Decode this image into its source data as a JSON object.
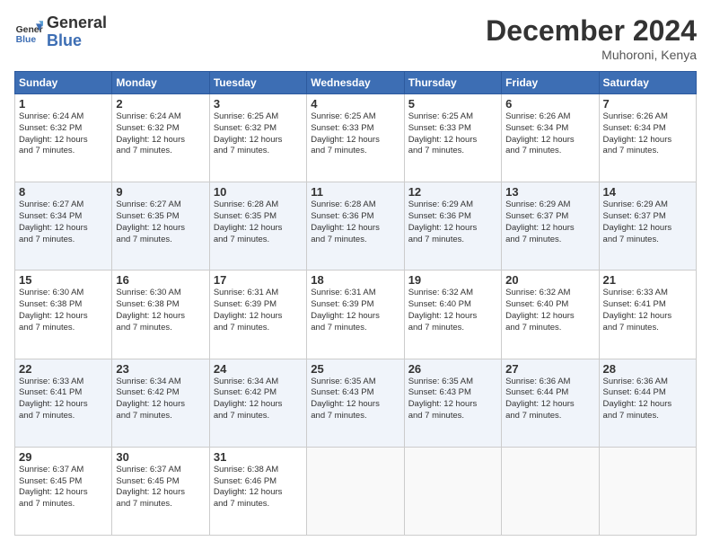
{
  "logo": {
    "line1": "General",
    "line2": "Blue"
  },
  "title": "December 2024",
  "subtitle": "Muhoroni, Kenya",
  "days_header": [
    "Sunday",
    "Monday",
    "Tuesday",
    "Wednesday",
    "Thursday",
    "Friday",
    "Saturday"
  ],
  "weeks": [
    [
      {
        "day": "1",
        "sunrise": "6:24 AM",
        "sunset": "6:32 PM",
        "daylight": "12 hours and 7 minutes."
      },
      {
        "day": "2",
        "sunrise": "6:24 AM",
        "sunset": "6:32 PM",
        "daylight": "12 hours and 7 minutes."
      },
      {
        "day": "3",
        "sunrise": "6:25 AM",
        "sunset": "6:32 PM",
        "daylight": "12 hours and 7 minutes."
      },
      {
        "day": "4",
        "sunrise": "6:25 AM",
        "sunset": "6:33 PM",
        "daylight": "12 hours and 7 minutes."
      },
      {
        "day": "5",
        "sunrise": "6:25 AM",
        "sunset": "6:33 PM",
        "daylight": "12 hours and 7 minutes."
      },
      {
        "day": "6",
        "sunrise": "6:26 AM",
        "sunset": "6:34 PM",
        "daylight": "12 hours and 7 minutes."
      },
      {
        "day": "7",
        "sunrise": "6:26 AM",
        "sunset": "6:34 PM",
        "daylight": "12 hours and 7 minutes."
      }
    ],
    [
      {
        "day": "8",
        "sunrise": "6:27 AM",
        "sunset": "6:34 PM",
        "daylight": "12 hours and 7 minutes."
      },
      {
        "day": "9",
        "sunrise": "6:27 AM",
        "sunset": "6:35 PM",
        "daylight": "12 hours and 7 minutes."
      },
      {
        "day": "10",
        "sunrise": "6:28 AM",
        "sunset": "6:35 PM",
        "daylight": "12 hours and 7 minutes."
      },
      {
        "day": "11",
        "sunrise": "6:28 AM",
        "sunset": "6:36 PM",
        "daylight": "12 hours and 7 minutes."
      },
      {
        "day": "12",
        "sunrise": "6:29 AM",
        "sunset": "6:36 PM",
        "daylight": "12 hours and 7 minutes."
      },
      {
        "day": "13",
        "sunrise": "6:29 AM",
        "sunset": "6:37 PM",
        "daylight": "12 hours and 7 minutes."
      },
      {
        "day": "14",
        "sunrise": "6:29 AM",
        "sunset": "6:37 PM",
        "daylight": "12 hours and 7 minutes."
      }
    ],
    [
      {
        "day": "15",
        "sunrise": "6:30 AM",
        "sunset": "6:38 PM",
        "daylight": "12 hours and 7 minutes."
      },
      {
        "day": "16",
        "sunrise": "6:30 AM",
        "sunset": "6:38 PM",
        "daylight": "12 hours and 7 minutes."
      },
      {
        "day": "17",
        "sunrise": "6:31 AM",
        "sunset": "6:39 PM",
        "daylight": "12 hours and 7 minutes."
      },
      {
        "day": "18",
        "sunrise": "6:31 AM",
        "sunset": "6:39 PM",
        "daylight": "12 hours and 7 minutes."
      },
      {
        "day": "19",
        "sunrise": "6:32 AM",
        "sunset": "6:40 PM",
        "daylight": "12 hours and 7 minutes."
      },
      {
        "day": "20",
        "sunrise": "6:32 AM",
        "sunset": "6:40 PM",
        "daylight": "12 hours and 7 minutes."
      },
      {
        "day": "21",
        "sunrise": "6:33 AM",
        "sunset": "6:41 PM",
        "daylight": "12 hours and 7 minutes."
      }
    ],
    [
      {
        "day": "22",
        "sunrise": "6:33 AM",
        "sunset": "6:41 PM",
        "daylight": "12 hours and 7 minutes."
      },
      {
        "day": "23",
        "sunrise": "6:34 AM",
        "sunset": "6:42 PM",
        "daylight": "12 hours and 7 minutes."
      },
      {
        "day": "24",
        "sunrise": "6:34 AM",
        "sunset": "6:42 PM",
        "daylight": "12 hours and 7 minutes."
      },
      {
        "day": "25",
        "sunrise": "6:35 AM",
        "sunset": "6:43 PM",
        "daylight": "12 hours and 7 minutes."
      },
      {
        "day": "26",
        "sunrise": "6:35 AM",
        "sunset": "6:43 PM",
        "daylight": "12 hours and 7 minutes."
      },
      {
        "day": "27",
        "sunrise": "6:36 AM",
        "sunset": "6:44 PM",
        "daylight": "12 hours and 7 minutes."
      },
      {
        "day": "28",
        "sunrise": "6:36 AM",
        "sunset": "6:44 PM",
        "daylight": "12 hours and 7 minutes."
      }
    ],
    [
      {
        "day": "29",
        "sunrise": "6:37 AM",
        "sunset": "6:45 PM",
        "daylight": "12 hours and 7 minutes."
      },
      {
        "day": "30",
        "sunrise": "6:37 AM",
        "sunset": "6:45 PM",
        "daylight": "12 hours and 7 minutes."
      },
      {
        "day": "31",
        "sunrise": "6:38 AM",
        "sunset": "6:46 PM",
        "daylight": "12 hours and 7 minutes."
      },
      null,
      null,
      null,
      null
    ]
  ],
  "labels": {
    "sunrise": "Sunrise:",
    "sunset": "Sunset:",
    "daylight": "Daylight:"
  }
}
